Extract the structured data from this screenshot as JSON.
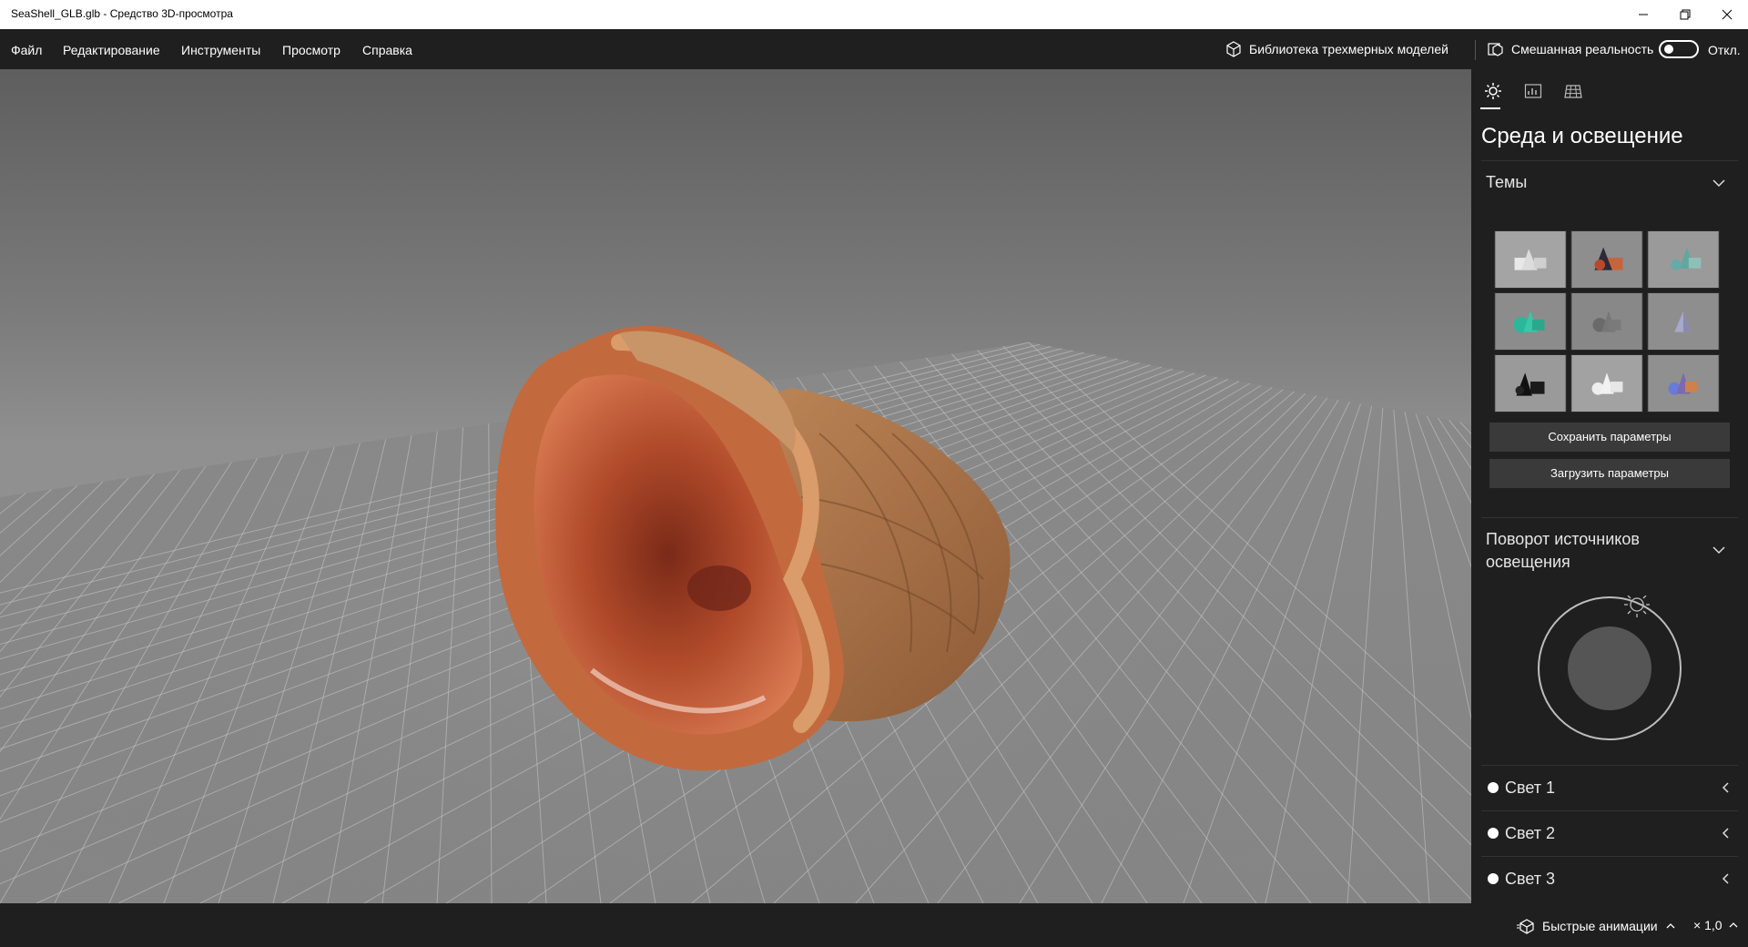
{
  "window": {
    "title": "SeaShell_GLB.glb - Средство 3D-просмотра",
    "controls": [
      "minimize-icon",
      "restore-icon",
      "close-icon"
    ]
  },
  "menu": {
    "items": [
      "Файл",
      "Редактирование",
      "Инструменты",
      "Просмотр",
      "Справка"
    ],
    "library_label": "Библиотека трехмерных моделей",
    "mixed_reality_label": "Смешанная реальность",
    "toggle_state": "Откл."
  },
  "panel": {
    "tabs": [
      {
        "icon": "sun-icon",
        "selected": true
      },
      {
        "icon": "stats-icon",
        "selected": false
      },
      {
        "icon": "grid-icon",
        "selected": false
      }
    ],
    "title": "Среда и освещение",
    "themes_header": "Темы",
    "save_button": "Сохранить параметры",
    "load_button": "Загрузить параметры",
    "rotation_header": "Поворот источников освещения",
    "lights": [
      "Свет 1",
      "Свет 2",
      "Свет 3"
    ]
  },
  "status": {
    "animations_label": "Быстрые анимации",
    "speed": "× 1,0"
  },
  "colors": {
    "accent": "#ffffff",
    "chrome": "#1f1f1f",
    "button": "#3a3a3a"
  }
}
